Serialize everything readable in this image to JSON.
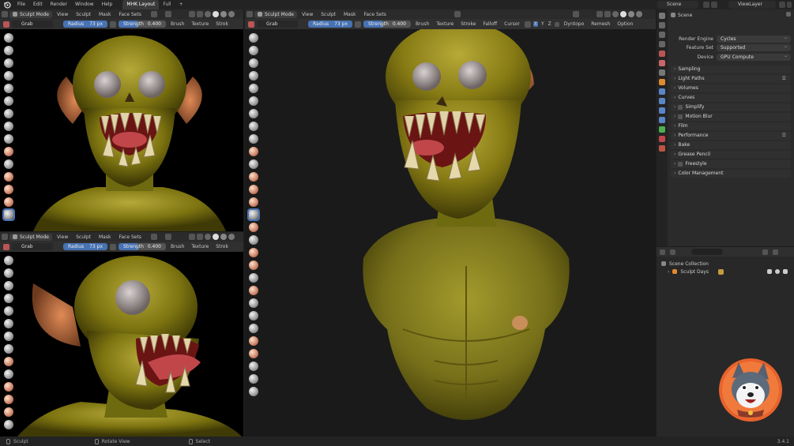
{
  "topbar": {
    "menu": [
      "File",
      "Edit",
      "Render",
      "Window",
      "Help"
    ],
    "workspaces": [
      "MHK Layout",
      "Full"
    ],
    "add_tab": "+",
    "scene": "Scene",
    "view_layer": "ViewLayer"
  },
  "viewport_header": {
    "mode": "Sculpt Mode",
    "menus": [
      "View",
      "Sculpt",
      "Mask",
      "Face Sets"
    ]
  },
  "tool_settings": {
    "tool": "Grab",
    "radius_label": "Radius",
    "radius_value": "73 px",
    "strength_label": "Strength",
    "strength_value": "0.400",
    "strength_fraction": 0.4,
    "brush": "Brush",
    "texture": "Texture",
    "stroke": "Stroke",
    "stroke_short": "Strok",
    "falloff": "Falloff",
    "cursor": "Cursor",
    "axes": [
      "X",
      "Y",
      "Z"
    ],
    "dyntopo": "Dyntopo",
    "remesh": "Remesh",
    "options": "Option"
  },
  "properties": {
    "scene_name": "Scene",
    "render_engine_label": "Render Engine",
    "render_engine": "Cycles",
    "feature_set_label": "Feature Set",
    "feature_set": "Supported",
    "device_label": "Device",
    "device": "GPU Compute",
    "panels": [
      "Sampling",
      "Light Paths",
      "Volumes",
      "Curves",
      "Simplify",
      "Motion Blur",
      "Film",
      "Performance",
      "Bake",
      "Grease Pencil",
      "Freestyle",
      "Color Management"
    ]
  },
  "outliner": {
    "collection": "Scene Collection",
    "item": "Sculpt Days"
  },
  "statusbar": {
    "left": "Sculpt",
    "middle": "Rotate View",
    "right": "Select",
    "version": "3.4.1"
  },
  "colors": {
    "accent": "#4772b3",
    "skin": "#8f8a1e",
    "background": "#000000"
  }
}
